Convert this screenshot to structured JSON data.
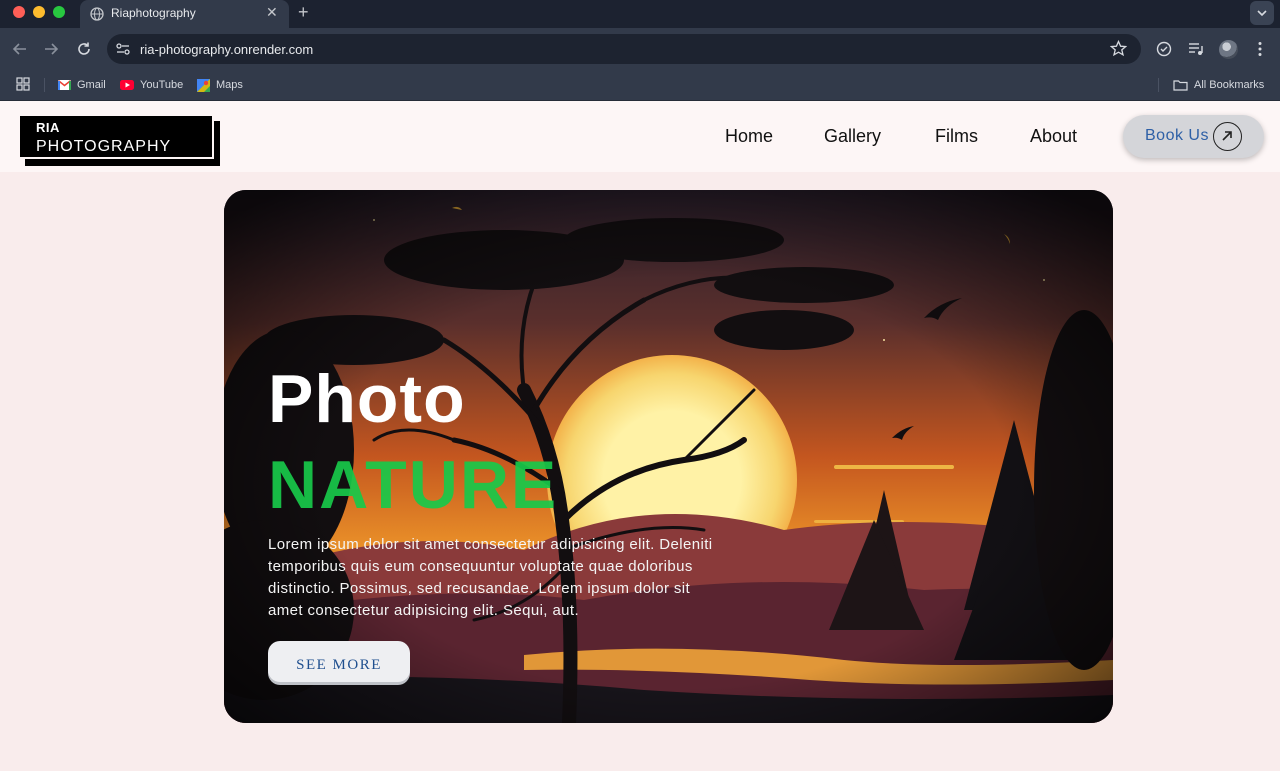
{
  "browser": {
    "tab_title": "Riaphotography",
    "url": "ria-photography.onrender.com",
    "bookmarks": [
      "Gmail",
      "YouTube",
      "Maps"
    ],
    "all_bookmarks_label": "All Bookmarks"
  },
  "site": {
    "logo_top": "RIA",
    "logo_bottom": "PHOTOGRAPHY",
    "nav": [
      "Home",
      "Gallery",
      "Films",
      "About"
    ],
    "cta_label": "Book Us"
  },
  "hero": {
    "title": "Photo",
    "subtitle": "NATURE",
    "body": "Lorem ipsum dolor sit amet consectetur adipisicing elit. Deleniti temporibus quis eum consequuntur voluptate quae doloribus distinctio. Possimus, sed recusandae. Lorem ipsum dolor sit amet consectetur adipisicing elit. Sequi, aut.",
    "button_label": "SEE MORE"
  },
  "colors": {
    "accent_green": "#18c94a",
    "link_blue": "#2d5fa6",
    "page_bg": "#f9ecec"
  }
}
